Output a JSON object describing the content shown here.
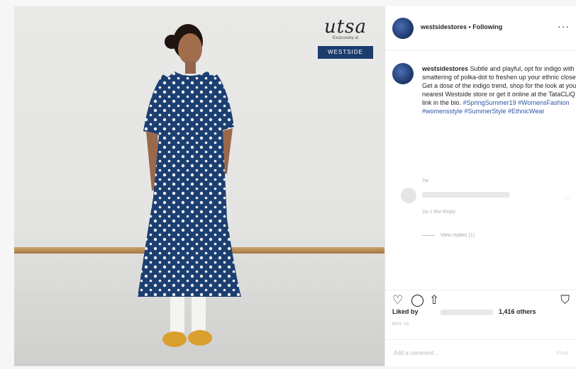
{
  "post": {
    "brand": {
      "script": "utsa",
      "tagline": "Exclusively at",
      "badge": "WESTSIDE"
    },
    "header": {
      "username": "westsidestores",
      "separator": "•",
      "follow_state": "Following",
      "more": "···"
    },
    "caption": {
      "username": "westsidestores",
      "text": "Subtle and playful, opt for indigo with a smattering of polka-dot to freshen up your ethnic closet. Get a dose of the indigo trend, shop for the look at your nearest Westside store or get it online at the TataCLiQ link in the bio.",
      "hashtags": "#SpringSummer19 #WomensFashion #womensstyle #SummerStyle #EthnicWear",
      "time": "2w"
    },
    "reply": {
      "meta": "2w   1 like   Reply",
      "view_replies": "View replies (1)"
    },
    "actions": {
      "like_icon": "heart-icon",
      "comment_icon": "comment-icon",
      "share_icon": "share-icon",
      "save_icon": "bookmark-icon"
    },
    "likes": {
      "prefix": "Liked by",
      "count": "1,416 others"
    },
    "date": "MAY 10",
    "comment": {
      "placeholder": "Add a comment...",
      "post_label": "Post"
    }
  },
  "colors": {
    "accent": "#2f55a4",
    "dress": "#1c3f72",
    "shoes": "#d9a030"
  }
}
